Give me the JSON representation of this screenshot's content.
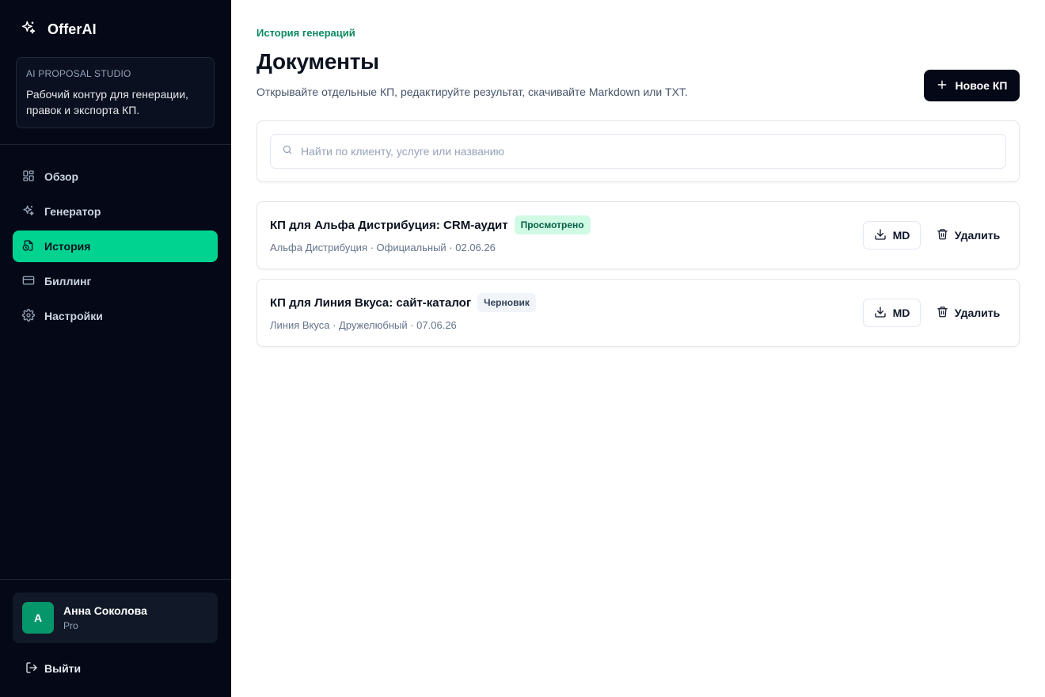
{
  "brand": {
    "name": "OfferAI",
    "icon": "sparkles-icon"
  },
  "studio": {
    "kicker": "AI PROPOSAL STUDIO",
    "text": "Рабочий контур для генерации, правок и экспорта КП."
  },
  "nav": {
    "items": [
      {
        "label": "Обзор",
        "icon": "dashboard-icon"
      },
      {
        "label": "Генератор",
        "icon": "sparkles-icon"
      },
      {
        "label": "История",
        "icon": "document-history-icon",
        "active": true
      },
      {
        "label": "Биллинг",
        "icon": "credit-card-icon"
      },
      {
        "label": "Настройки",
        "icon": "gear-icon"
      }
    ]
  },
  "user": {
    "initial": "A",
    "name": "Анна Соколова",
    "plan": "Pro"
  },
  "logout": {
    "label": "Выйти"
  },
  "header": {
    "kicker": "История генераций",
    "title": "Документы",
    "subtitle": "Открывайте отдельные КП, редактируйте результат, скачивайте Markdown или TXT.",
    "new_button": "Новое КП"
  },
  "search": {
    "placeholder": "Найти по клиенту, услуге или названию",
    "value": ""
  },
  "documents": [
    {
      "title": "КП для Альфа Дистрибуция: CRM-аудит",
      "status": "Просмотрено",
      "meta": "Альфа Дистрибуция · Официальный · 02.06.26",
      "md_label": "MD",
      "delete_label": "Удалить"
    },
    {
      "title": "КП для Линия Вкуса: сайт-каталог",
      "status": "Черновик",
      "meta": "Линия Вкуса · Дружелюбный · 07.06.26",
      "md_label": "MD",
      "delete_label": "Удалить"
    }
  ],
  "colors": {
    "sidebar_bg": "#050816",
    "accent": "#00d28f",
    "kicker": "#0a8a5c",
    "badge_viewed_bg": "#d1fae5",
    "badge_draft_bg": "#f1f5f9"
  }
}
